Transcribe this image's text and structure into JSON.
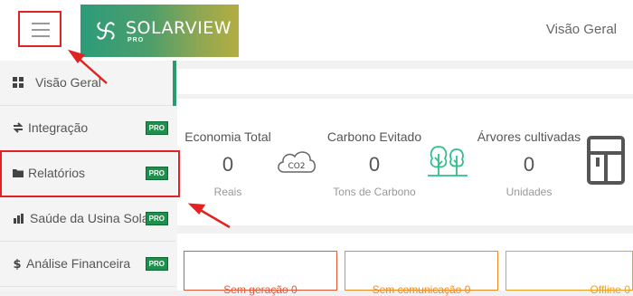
{
  "header": {
    "logo_name": "SOLARVIEW",
    "logo_sub": "PRO",
    "page_title": "Visão Geral",
    "brand_colors": [
      "#2c9b7a",
      "#b3ad42"
    ]
  },
  "sidebar": {
    "items": [
      {
        "label": "Visão Geral",
        "icon": "grid-icon",
        "active": true
      },
      {
        "label": "Integração",
        "icon": "exchange-icon",
        "pro": "PRO"
      },
      {
        "label": "Relatórios",
        "icon": "folder-icon",
        "pro": "PRO"
      },
      {
        "label": "Saúde da Usina Solar",
        "icon": "bar-chart-icon",
        "pro": "PRO"
      },
      {
        "label": "Análise Financeira",
        "icon": "dollar-icon",
        "pro": "PRO"
      }
    ]
  },
  "stats": [
    {
      "title": "Economia Total",
      "value": "0",
      "unit": "Reais"
    },
    {
      "title": "Carbono Evitado",
      "value": "0",
      "unit": "Tons de Carbono",
      "icon_text": "CO2"
    },
    {
      "title": "Árvores cultivadas",
      "value": "0",
      "unit": "Unidades"
    }
  ],
  "status": [
    {
      "label": "Sem geração",
      "count": "0",
      "color": "#e05a3a"
    },
    {
      "label": "Sem comunicação",
      "count": "0",
      "color": "#f08a24"
    },
    {
      "label": "Offline",
      "count": "0",
      "color": "#f0a020"
    }
  ],
  "annotation_color": "#e32222"
}
